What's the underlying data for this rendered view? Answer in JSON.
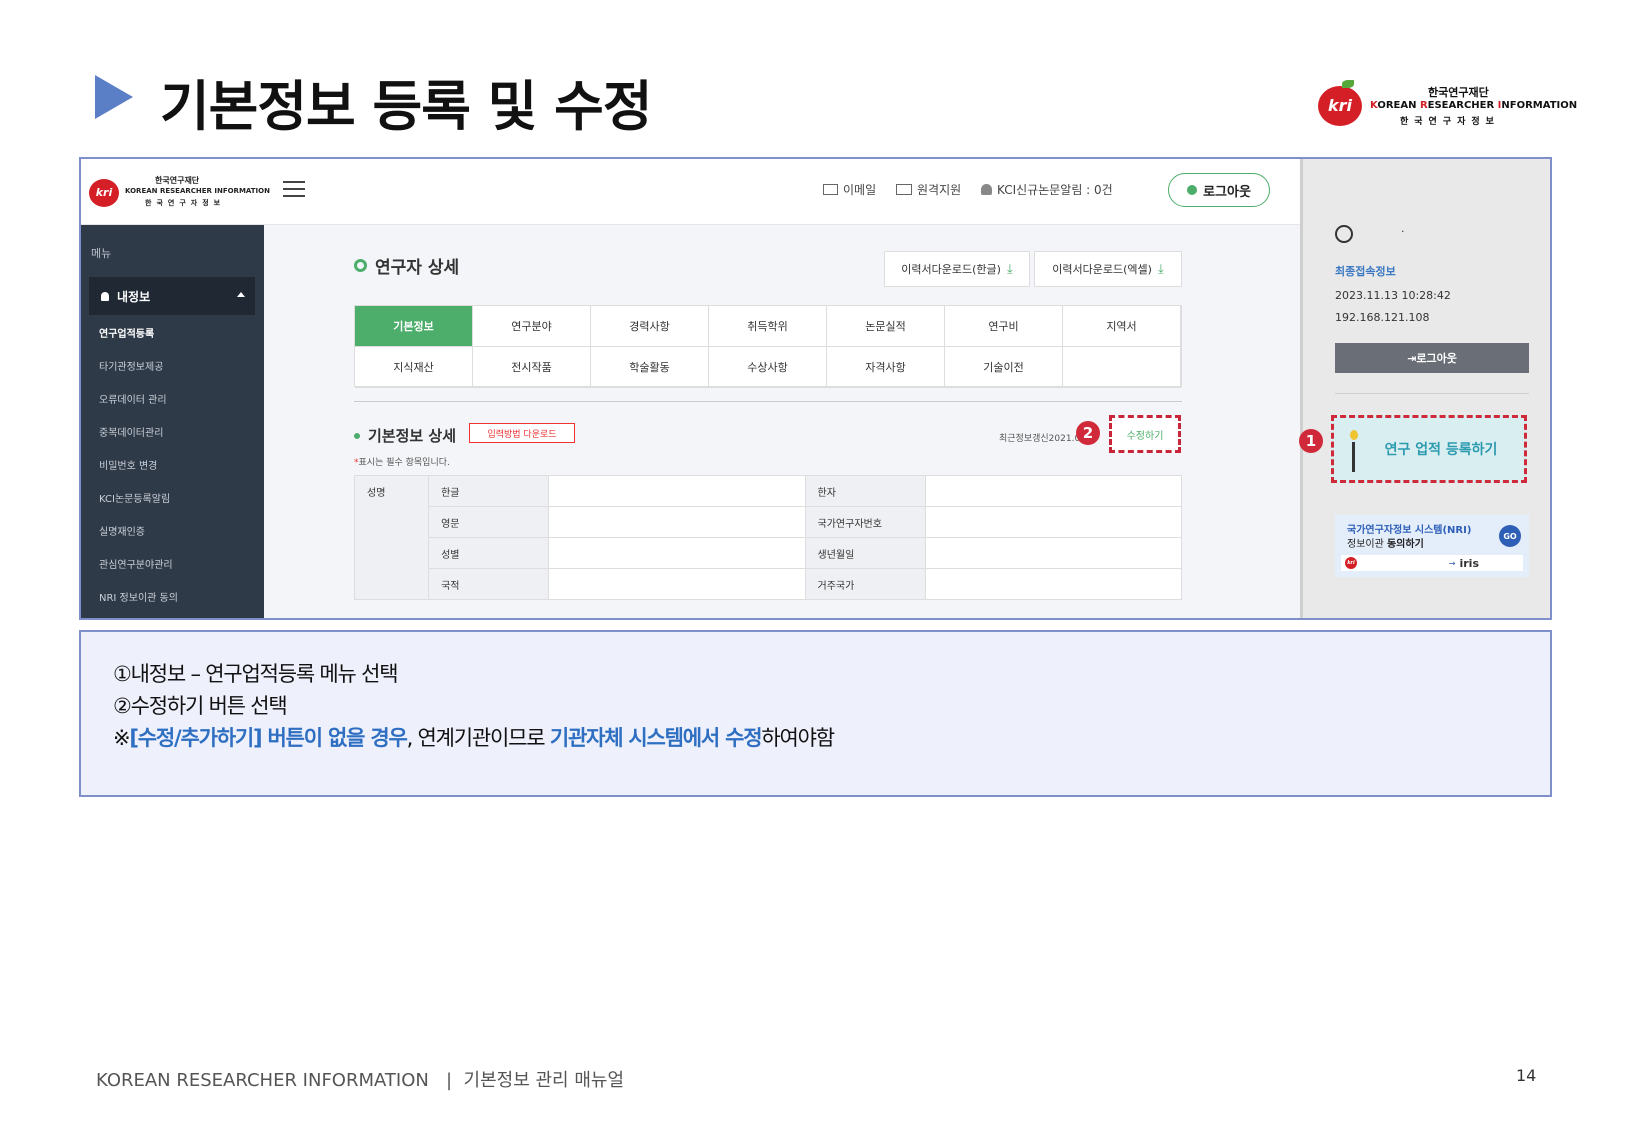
{
  "slide": {
    "title": "기본정보 등록 및 수정",
    "brand": {
      "ko": "한국연구재단",
      "en_k": "K",
      "en_1": "OREAN ",
      "en_r": "R",
      "en_2": "ESEARCHER ",
      "en_i": "I",
      "en_3": "NFORMATION",
      "sub": "한국연구자정보"
    }
  },
  "app": {
    "logo": {
      "ko": "한국연구재단",
      "en": "KOREAN RESEARCHER INFORMATION",
      "sub": "한국연구자정보"
    },
    "topbar": {
      "email": "이메일",
      "remote": "원격지원",
      "kci": "KCI신규논문알림 : 0건",
      "logout": "로그아웃"
    },
    "sidebar": {
      "menu_label": "메뉴",
      "active": "내정보",
      "items": [
        "연구업적등록",
        "타기관정보제공",
        "오류데이터 관리",
        "중복데이터관리",
        "비밀번호 변경",
        "KCI논문등록알림",
        "실명재인증",
        "관심연구분야관리",
        "NRI 정보이관 동의"
      ]
    },
    "content": {
      "section_title": "연구자 상세",
      "download_ko": "이력서다운로드(한글)",
      "download_xls": "이력서다운로드(엑셀)",
      "tabs": [
        "기본정보",
        "연구분야",
        "경력사항",
        "취득학위",
        "논문실적",
        "연구비",
        "지역서",
        "지식재산",
        "전시작품",
        "학술활동",
        "수상사항",
        "자격사항",
        "기술이전"
      ],
      "sub_title": "기본정보 상세",
      "input_download": "입력방법 다운로드",
      "required_star": "*",
      "required_note": "표시는 필수 항목입니다.",
      "updated": "최근정보갱신2021.0",
      "edit_button": "수정하기",
      "table": {
        "group": "성명",
        "rows": [
          {
            "left": "한글",
            "right": "한자"
          },
          {
            "left": "영문",
            "right": "국가연구자번호"
          },
          {
            "left": "성별",
            "right": "생년월일"
          },
          {
            "left": "국적",
            "right": "거주국가"
          }
        ]
      }
    },
    "right_panel": {
      "dot": "·",
      "last_login_label": "최종접속정보",
      "last_login_time": "2023.11.13 10:28:42",
      "last_login_ip": "192.168.121.108",
      "logout": "로그아웃",
      "register": "연구 업적 등록하기",
      "nri_line1": "국가연구자정보 시스템(NRI)",
      "nri_line2_a": "정보이관 ",
      "nri_line2_b": "동의하기",
      "go": "GO",
      "iris": "iris"
    },
    "badges": [
      "1",
      "2"
    ]
  },
  "description": {
    "line1": "①내정보 – 연구업적등록 메뉴 선택",
    "line2": "②수정하기 버튼 선택",
    "line3_a": "※",
    "line3_b": "[수정/추가하기] 버튼이 없을 경우",
    "line3_c": ", 연계기관이므로 ",
    "line3_d": "기관자체 시스템에서 수정",
    "line3_e": "하여야함"
  },
  "footer": {
    "text": "KOREAN RESEARCHER INFORMATION   |  기본정보 관리 매뉴얼",
    "page": "14"
  },
  "colors": {
    "accent": "#4cae6a",
    "highlight": "#2e6fc2",
    "badge": "#d02a3a",
    "frame": "#7f8fc9"
  }
}
